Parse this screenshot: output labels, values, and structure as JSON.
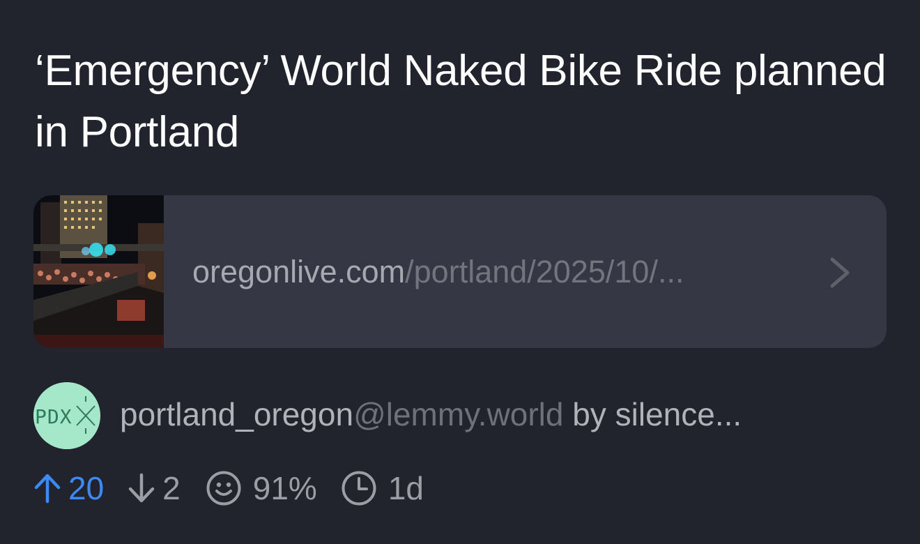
{
  "post": {
    "title": "‘Emergency’ World Naked Bike Ride planned in Portland",
    "link": {
      "domain": "oregonlive.com",
      "path": "/portland/2025/10/...",
      "thumbnail_icon": "article-thumbnail-image",
      "chevron_icon": "chevron-right-icon"
    },
    "community": {
      "name": "portland_oregon",
      "instance": "@lemmy.world",
      "by_label": "by",
      "author": "silence...",
      "avatar_text": "PDX",
      "avatar_color": "#a5e8c9"
    },
    "stats": {
      "upvotes": "20",
      "downvotes": "2",
      "score_percent": "91%",
      "age": "1d",
      "upvote_color": "#3d8af7"
    }
  }
}
